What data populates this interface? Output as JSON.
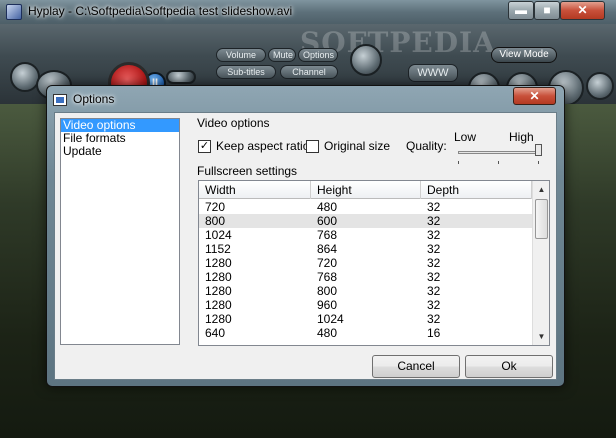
{
  "main_window": {
    "title": "Hyplay - C:\\Softpedia\\Softpedia test slideshow.avi",
    "controls": {
      "minimize": "▬",
      "maximize": "■",
      "close": "✕"
    }
  },
  "skin": {
    "watermark": "SOFTPEDIA",
    "buttons": {
      "volume": "Volume",
      "mute": "Mute",
      "options": "Options",
      "subtitles": "Sub-titles",
      "channel": "Channel",
      "www": "WWW",
      "view_mode": "View Mode",
      "pause": "II"
    }
  },
  "dialog": {
    "title": "Options",
    "close": "✕",
    "categories": [
      "Video options",
      "File formats",
      "Update"
    ],
    "selected_category": "Video options",
    "section_title": "Video options",
    "keep_aspect": {
      "label": "Keep aspect ratio",
      "checked": true,
      "mark": "✓"
    },
    "original_size": {
      "label": "Original size",
      "checked": false,
      "mark": ""
    },
    "quality": {
      "label": "Quality:",
      "low": "Low",
      "high": "High",
      "value": 1.0
    },
    "fullscreen_label": "Fullscreen settings",
    "table": {
      "headers": [
        "Width",
        "Height",
        "Depth"
      ],
      "rows": [
        [
          "720",
          "480",
          "32"
        ],
        [
          "800",
          "600",
          "32"
        ],
        [
          "1024",
          "768",
          "32"
        ],
        [
          "1152",
          "864",
          "32"
        ],
        [
          "1280",
          "720",
          "32"
        ],
        [
          "1280",
          "768",
          "32"
        ],
        [
          "1280",
          "800",
          "32"
        ],
        [
          "1280",
          "960",
          "32"
        ],
        [
          "1280",
          "1024",
          "32"
        ],
        [
          "640",
          "480",
          "16"
        ]
      ],
      "selected_row": 1,
      "scroll_up": "▲",
      "scroll_down": "▼"
    },
    "buttons": {
      "cancel": "Cancel",
      "ok": "Ok"
    }
  }
}
